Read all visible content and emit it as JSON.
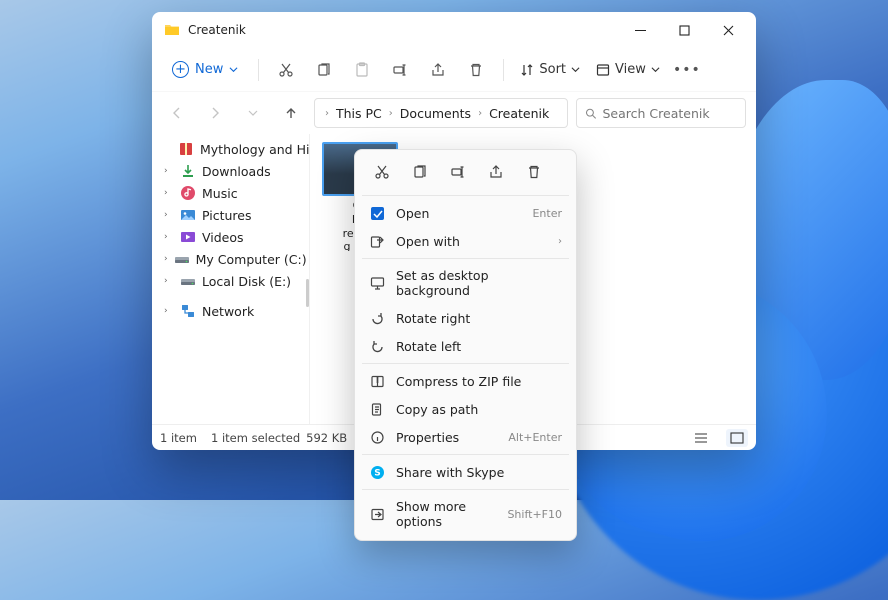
{
  "window": {
    "title": "Createnik"
  },
  "toolbar": {
    "new_label": "New",
    "sort_label": "Sort",
    "view_label": "View"
  },
  "breadcrumb": {
    "items": [
      "This PC",
      "Documents",
      "Createnik"
    ]
  },
  "search": {
    "placeholder": "Search Createnik"
  },
  "sidebar": {
    "items": [
      {
        "label": "Mythology and History.z",
        "icon": "archive",
        "expandable": false
      },
      {
        "label": "Downloads",
        "icon": "download",
        "expandable": true
      },
      {
        "label": "Music",
        "icon": "music",
        "expandable": true
      },
      {
        "label": "Pictures",
        "icon": "pictures",
        "expandable": true
      },
      {
        "label": "Videos",
        "icon": "videos",
        "expandable": true
      },
      {
        "label": "My Computer (C:)",
        "icon": "drive",
        "expandable": true
      },
      {
        "label": "Local Disk (E:)",
        "icon": "drive",
        "expandable": true
      },
      {
        "label": "Network",
        "icon": "network",
        "expandable": true
      }
    ]
  },
  "file": {
    "name": "Ch\nPie\nrepres\ng trad"
  },
  "statusbar": {
    "count": "1 item",
    "selection": "1 item selected",
    "size": "592 KB"
  },
  "context_menu": {
    "items": [
      {
        "label": "Open",
        "accel": "Enter",
        "icon": "open"
      },
      {
        "label": "Open with",
        "submenu": true,
        "icon": "openwith"
      },
      {
        "label": "Set as desktop background",
        "icon": "desktop"
      },
      {
        "label": "Rotate right",
        "icon": "rotr"
      },
      {
        "label": "Rotate left",
        "icon": "rotl"
      },
      {
        "label": "Compress to ZIP file",
        "icon": "zip"
      },
      {
        "label": "Copy as path",
        "icon": "copypath"
      },
      {
        "label": "Properties",
        "accel": "Alt+Enter",
        "icon": "props"
      },
      {
        "label": "Share with Skype",
        "icon": "skype"
      },
      {
        "label": "Show more options",
        "accel": "Shift+F10",
        "icon": "more"
      }
    ]
  }
}
